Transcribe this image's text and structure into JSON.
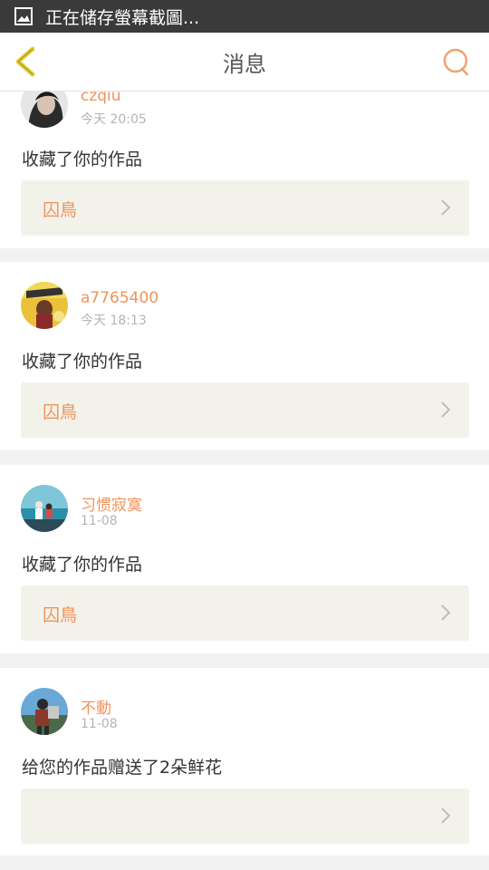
{
  "status_bar": {
    "notification": "正在储存螢幕截圖..."
  },
  "app_bar": {
    "title": "消息"
  },
  "notifications": [
    {
      "user": "czqiu",
      "time": "今天 20:05",
      "message": "收藏了你的作品",
      "work_title": "囚鳥"
    },
    {
      "user": "a7765400",
      "time": "今天 18:13",
      "message": "收藏了你的作品",
      "work_title": "囚鳥"
    },
    {
      "user": "习惯寂寞",
      "time": "11-08",
      "message": "收藏了你的作品",
      "work_title": "囚鳥"
    },
    {
      "user": "不動",
      "time": "11-08",
      "message": "给您的作品赠送了2朵鲜花",
      "work_title": ""
    }
  ],
  "colors": {
    "accent": "#f0935a",
    "back_arrow": "#e8d23a",
    "card_bg": "#f3f2ea"
  }
}
